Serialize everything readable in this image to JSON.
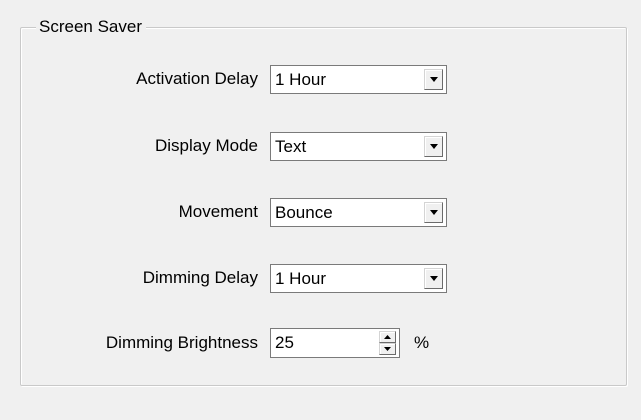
{
  "group": {
    "title": "Screen Saver"
  },
  "fields": {
    "activation_delay": {
      "label": "Activation Delay",
      "value": "1 Hour"
    },
    "display_mode": {
      "label": "Display Mode",
      "value": "Text"
    },
    "movement": {
      "label": "Movement",
      "value": "Bounce"
    },
    "dimming_delay": {
      "label": "Dimming Delay",
      "value": "1 Hour"
    },
    "dimming_brightness": {
      "label": "Dimming Brightness",
      "value": "25",
      "unit": "%"
    }
  },
  "icons": {
    "dropdown": "chevron-down-icon",
    "spin_up": "arrow-up-icon",
    "spin_down": "arrow-down-icon"
  }
}
